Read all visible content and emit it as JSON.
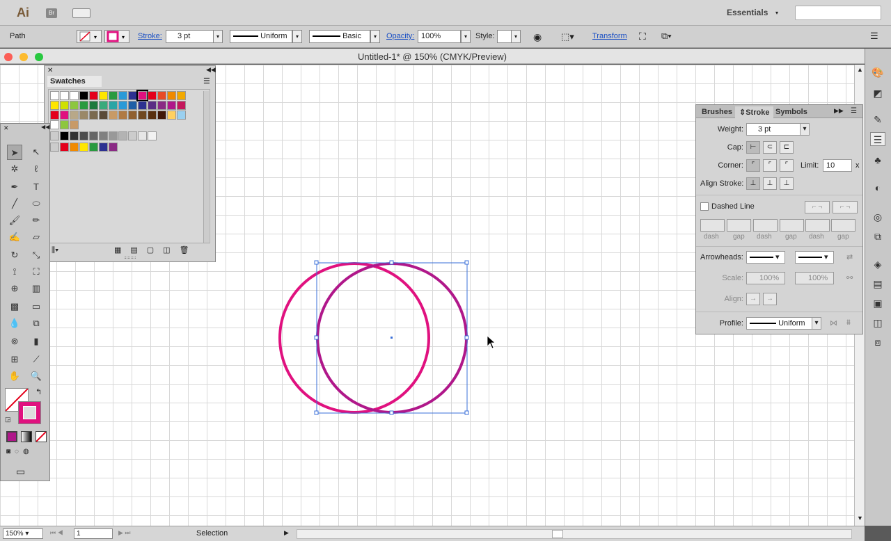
{
  "app": {
    "logo": "Ai",
    "bridge": "Br",
    "workspace": "Essentials"
  },
  "control": {
    "selection": "Path",
    "stroke_label": "Stroke:",
    "stroke_weight": "3 pt",
    "variable_width": "Uniform",
    "brush": "Basic",
    "opacity_label": "Opacity:",
    "opacity": "100%",
    "style_label": "Style:",
    "transform": "Transform"
  },
  "document": {
    "title": "Untitled-1* @ 150% (CMYK/Preview)"
  },
  "status": {
    "zoom": "150%",
    "artboard": "1",
    "tool": "Selection"
  },
  "swatches_panel": {
    "title": "Swatches"
  },
  "stroke_panel": {
    "tabs": [
      "Brushes",
      "Stroke",
      "Symbols"
    ],
    "weight_label": "Weight:",
    "weight": "3 pt",
    "cap_label": "Cap:",
    "corner_label": "Corner:",
    "limit_label": "Limit:",
    "limit": "10",
    "limit_unit": "x",
    "align_label": "Align Stroke:",
    "dashed_label": "Dashed Line",
    "dash_labels": [
      "dash",
      "gap",
      "dash",
      "gap",
      "dash",
      "gap"
    ],
    "arrowheads_label": "Arrowheads:",
    "scale_label": "Scale:",
    "scale1": "100%",
    "scale2": "100%",
    "align2_label": "Align:",
    "profile_label": "Profile:",
    "profile": "Uniform"
  },
  "colors": {
    "accent": "#e0117f",
    "selection": "#3a6fd8",
    "circle2": "#b0178a"
  },
  "swatches": [
    [
      "#ffffff",
      "#ffffff",
      "#ffffff",
      "#000000",
      "#e4001b",
      "#ffe600",
      "#2a9a3f",
      "#2a9ad8",
      "#2d3191",
      "#e0117f",
      "#e4001b",
      "#e84a25",
      "#f08a00",
      "#f2a900"
    ],
    [
      "#ffe600",
      "#cfe000",
      "#8dc63f",
      "#2a9a3f",
      "#1e7a3c",
      "#3aaa7c",
      "#2aa5a5",
      "#2a9ad8",
      "#1f5fa6",
      "#2d3191",
      "#5a2d84",
      "#8a2a84",
      "#b0178a",
      "#c4185d"
    ],
    [
      "#e4001b",
      "#e0117f",
      "#b8a888",
      "#9a8868",
      "#7a6a50",
      "#5a4a38",
      "#c89a66",
      "#b07a44",
      "#906030",
      "#704820",
      "#583010",
      "#401808",
      "#ffd060",
      "#9ad0f0"
    ],
    [
      "#ffffff",
      "#8dc63f",
      "#c89a66"
    ],
    [
      "#000000",
      "#333333",
      "#4d4d4d",
      "#666666",
      "#808080",
      "#999999",
      "#b3b3b3",
      "#cccccc",
      "#e6e6e6",
      "#f2f2f2"
    ],
    [
      "#e4001b",
      "#f08a00",
      "#ffe600",
      "#2a9a3f",
      "#2d3191",
      "#8a2a84"
    ]
  ]
}
